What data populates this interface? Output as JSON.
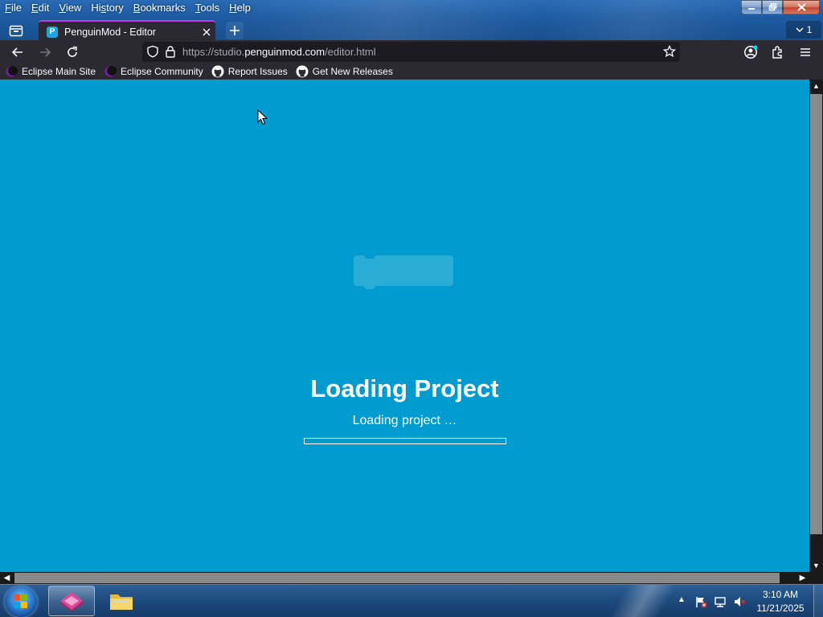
{
  "menu": {
    "items": [
      {
        "key": "F",
        "rest": "ile"
      },
      {
        "key": "E",
        "rest": "dit"
      },
      {
        "key": "V",
        "rest": "iew"
      },
      {
        "key": "",
        "pre": "Hi",
        "key2": "s",
        "rest": "tory"
      },
      {
        "key": "B",
        "rest": "ookmarks"
      },
      {
        "key": "T",
        "rest": "ools"
      },
      {
        "key": "H",
        "rest": "elp"
      }
    ],
    "file": "File",
    "edit": "Edit",
    "view": "View",
    "history": "History",
    "bookmarks": "Bookmarks",
    "tools": "Tools",
    "help": "Help"
  },
  "window": {
    "minimize_icon": "minimize-icon",
    "restore_icon": "restore-icon",
    "close_icon": "close-icon"
  },
  "tabs": {
    "active_title": "PenguinMod - Editor",
    "overflow_count": "1"
  },
  "navbar": {
    "url_prefix": "https://studio.",
    "url_domain": "penguinmod.com",
    "url_path": "/editor.html"
  },
  "bookmarks": [
    {
      "label": "Eclipse Main Site",
      "icon": "eclipse-icon"
    },
    {
      "label": "Eclipse Community",
      "icon": "eclipse-icon"
    },
    {
      "label": "Report Issues",
      "icon": "github-icon"
    },
    {
      "label": "Get New Releases",
      "icon": "github-icon"
    }
  ],
  "page": {
    "background": "#009ccf",
    "loading_title": "Loading Project",
    "loading_status": "Loading project …",
    "progress": 0.0
  },
  "taskbar": {
    "time": "3:10 AM",
    "date": "11/21/2025"
  },
  "colors": {
    "accent_tab": "#c13dd9",
    "browser_chrome": "#2b2a33"
  }
}
